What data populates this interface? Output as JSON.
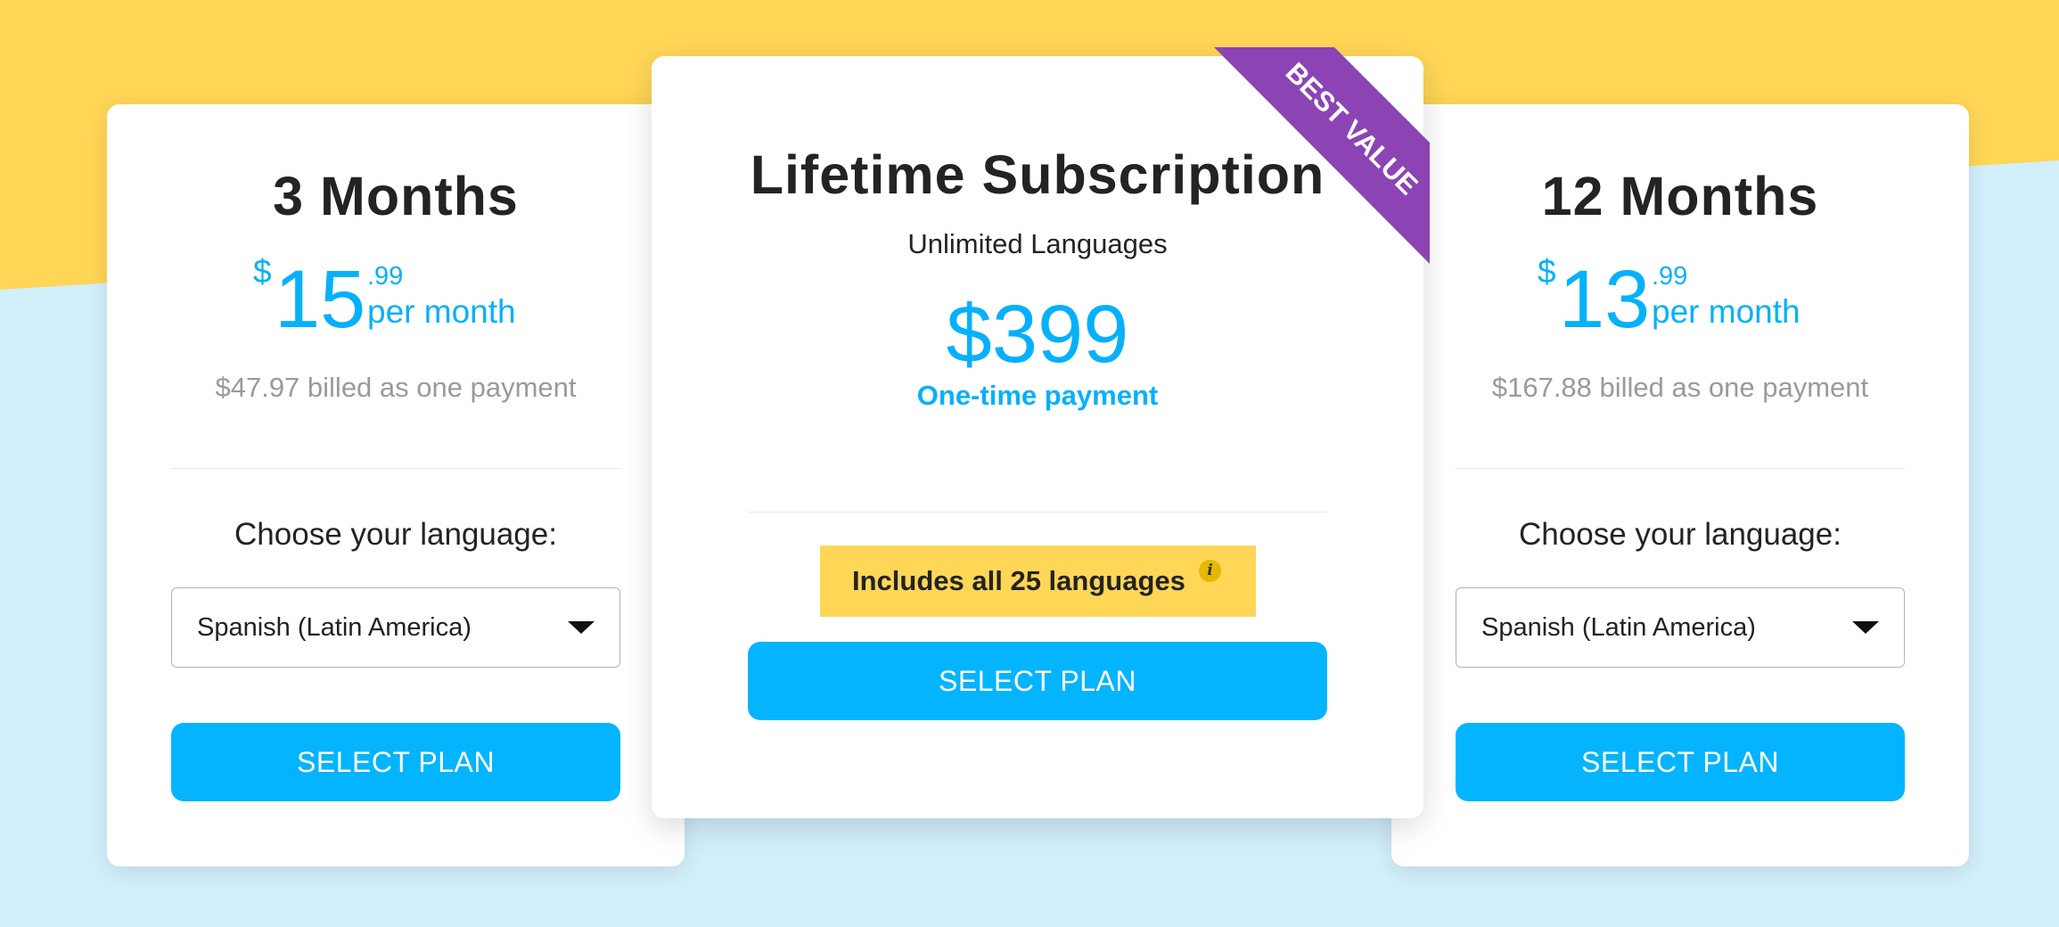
{
  "colors": {
    "accent": "#04b4ff",
    "price_blue": "#07b0fb",
    "yellow": "#ffd656",
    "sky": "#d2effc",
    "ribbon": "#8c44b4"
  },
  "plans": [
    {
      "title": "3 Months",
      "currency": "$",
      "price_int": "15",
      "price_cents": ".99",
      "period": "per month",
      "billed": "$47.97 billed as one payment",
      "choose_label": "Choose your language:",
      "language_value": "Spanish (Latin America)",
      "button_label": "SELECT PLAN"
    },
    {
      "title": "Lifetime Subscription",
      "ribbon": "BEST VALUE",
      "subtitle": "Unlimited Languages",
      "price": "$399",
      "payment_note": "One-time payment",
      "includes_label": "Includes all 25 languages",
      "info_icon_glyph": "i",
      "button_label": "SELECT PLAN"
    },
    {
      "title": "12 Months",
      "currency": "$",
      "price_int": "13",
      "price_cents": ".99",
      "period": "per month",
      "billed": "$167.88 billed as one payment",
      "choose_label": "Choose your language:",
      "language_value": "Spanish (Latin America)",
      "button_label": "SELECT PLAN"
    }
  ],
  "icons": {
    "dropdown": "chevron-down-icon",
    "info": "info-icon"
  }
}
